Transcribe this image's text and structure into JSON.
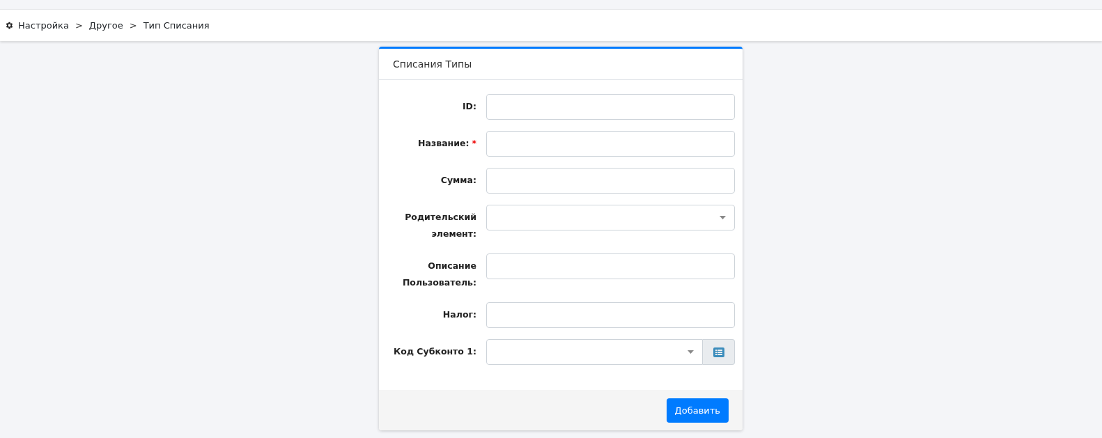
{
  "breadcrumbs": {
    "separator": ">",
    "items": [
      {
        "label": "Настройка"
      },
      {
        "label": "Другое"
      },
      {
        "label": "Тип Списания"
      }
    ]
  },
  "card": {
    "title": "Списания Типы",
    "fields": [
      {
        "label": "ID:",
        "kind": "text",
        "required": false
      },
      {
        "label": "Название:",
        "kind": "text",
        "required": true
      },
      {
        "label": "Сумма:",
        "kind": "text",
        "required": false
      },
      {
        "label": "Родительский элемент:",
        "kind": "select",
        "required": false
      },
      {
        "label": "Описание Пользователь:",
        "kind": "text",
        "required": false
      },
      {
        "label": "Налог:",
        "kind": "text",
        "required": false
      },
      {
        "label": "Код Субконто 1:",
        "kind": "select-addon",
        "required": false
      }
    ],
    "required_mark": "*",
    "submit": "Добавить"
  }
}
